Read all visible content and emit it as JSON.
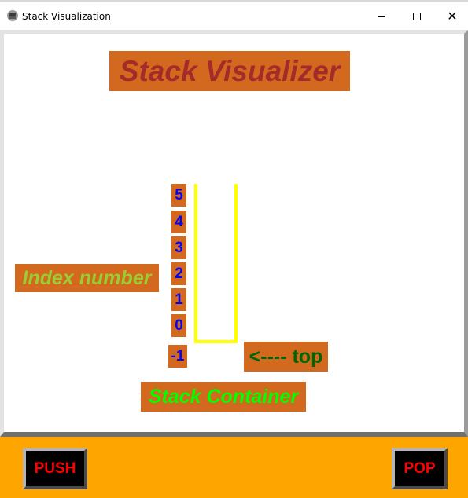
{
  "window": {
    "title": "Stack Visualization",
    "icon": "stack-app-icon",
    "controls": {
      "minimize": "minimize-icon",
      "maximize": "maximize-icon",
      "close": "close-icon"
    }
  },
  "canvas": {
    "heading": "Stack Visualizer",
    "index_label": "Index number",
    "top_label": "<---- top",
    "container_label": "Stack Container",
    "indices": [
      "5",
      "4",
      "3",
      "2",
      "1",
      "0",
      "-1"
    ]
  },
  "buttons": {
    "push": "PUSH",
    "pop": "POP"
  },
  "colors": {
    "label_bg": "#d2691e",
    "heading_text": "#a52a2a",
    "index_label_text": "#9acd32",
    "top_label_text": "#006400",
    "container_label_text": "#00ff00",
    "index_numbers": "#0000ff",
    "stack_outline": "#ffff00",
    "bottom_bar": "#ffa500",
    "button_bg": "#000000",
    "button_text": "#ff0000"
  }
}
